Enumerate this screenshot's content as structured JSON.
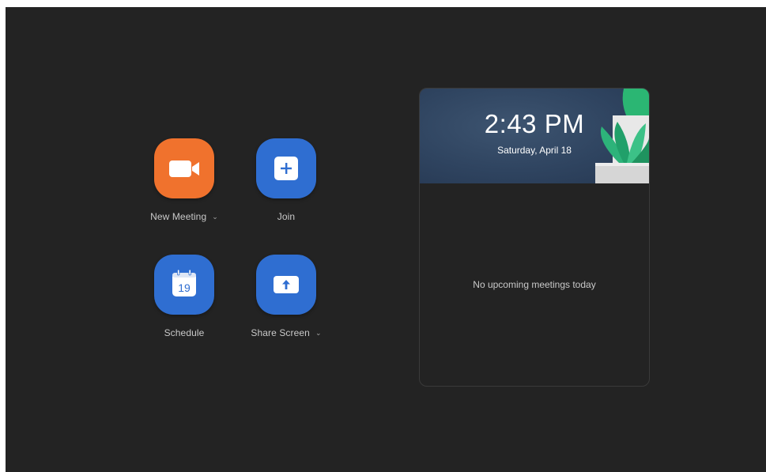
{
  "actions": {
    "new_meeting": {
      "label": "New Meeting",
      "has_dropdown": true,
      "color": "#f0722d"
    },
    "join": {
      "label": "Join",
      "color": "#2f6ed1"
    },
    "schedule": {
      "label": "Schedule",
      "calendar_day": "19",
      "color": "#2f6ed1"
    },
    "share_screen": {
      "label": "Share Screen",
      "has_dropdown": true,
      "color": "#2f6ed1"
    }
  },
  "upcoming": {
    "time": "2:43 PM",
    "date": "Saturday, April 18",
    "empty_message": "No upcoming meetings today"
  },
  "theme": {
    "background": "#232323",
    "label_color": "#c9c9c9",
    "banner_color": "#2f4460"
  }
}
